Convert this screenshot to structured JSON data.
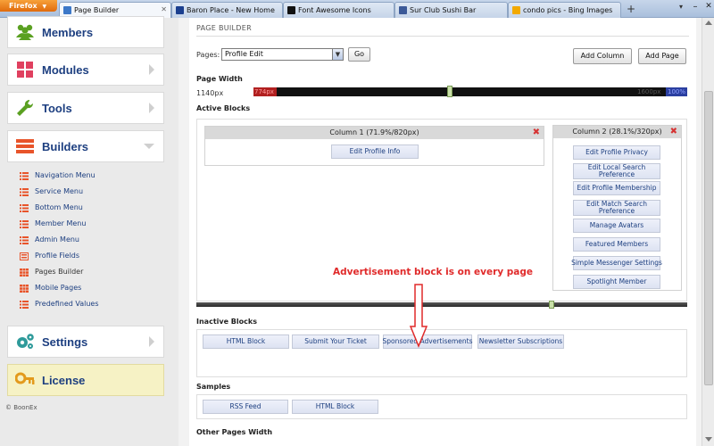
{
  "browser": {
    "firefox_button": "Firefox",
    "tabs": [
      {
        "label": "Page Builder",
        "active": true,
        "icon": "page-builder-favicon",
        "color": "#3c78c8"
      },
      {
        "label": "Baron Place - New Home",
        "active": false,
        "icon": "baron-place-favicon",
        "color": "#1b3f8f"
      },
      {
        "label": "Font Awesome Icons",
        "active": false,
        "icon": "font-awesome-favicon",
        "color": "#111111"
      },
      {
        "label": "Sur Club Sushi Bar",
        "active": false,
        "icon": "facebook-favicon",
        "color": "#3b5998"
      },
      {
        "label": "condo pics - Bing Images",
        "active": false,
        "icon": "bing-favicon",
        "color": "#f2a900"
      }
    ],
    "new_tab": "+",
    "tab_list": "▾",
    "minimize": "–",
    "close": "✕"
  },
  "sidebar": {
    "menus": [
      {
        "label": "Members",
        "icon": "members-icon",
        "color": "#5aa021",
        "arrow": "none"
      },
      {
        "label": "Modules",
        "icon": "modules-grid-icon",
        "color": "#e0405f",
        "arrow": "right"
      },
      {
        "label": "Tools",
        "icon": "wrench-icon",
        "color": "#5aa021",
        "arrow": "right"
      },
      {
        "label": "Builders",
        "icon": "builders-list-icon",
        "color": "#e8542a",
        "arrow": "down"
      },
      {
        "label": "Settings",
        "icon": "gears-icon",
        "color": "#2e9a9a",
        "arrow": "right"
      },
      {
        "label": "License",
        "icon": "key-icon",
        "color": "#e39a1c",
        "arrow": "none"
      }
    ],
    "builders_items": [
      {
        "label": "Navigation Menu",
        "icon": "list-icon"
      },
      {
        "label": "Service Menu",
        "icon": "list-icon"
      },
      {
        "label": "Bottom Menu",
        "icon": "list-icon"
      },
      {
        "label": "Member Menu",
        "icon": "list-icon"
      },
      {
        "label": "Admin Menu",
        "icon": "list-icon"
      },
      {
        "label": "Profile Fields",
        "icon": "form-icon"
      },
      {
        "label": "Pages Builder",
        "icon": "grid-icon",
        "current": true
      },
      {
        "label": "Mobile Pages",
        "icon": "grid-icon"
      },
      {
        "label": "Predefined Values",
        "icon": "list-icon"
      }
    ],
    "copyright": "© BoonEx"
  },
  "main": {
    "title": "PAGE BUILDER",
    "pages_label": "Pages:",
    "pages_selected": "Profile Edit",
    "go_button": "Go",
    "add_column_button": "Add Column",
    "add_page_button": "Add Page",
    "page_width_heading": "Page Width",
    "page_width_value": "1140px",
    "width_left_label": "774px",
    "width_right_label": "1600px",
    "width_percent_label": "100%",
    "width_fraction": 0.45,
    "active_blocks_heading": "Active Blocks",
    "columns": [
      {
        "title": "Column 1 (71.9%/820px)",
        "blocks": [
          "Edit Profile Info"
        ]
      },
      {
        "title": "Column 2 (28.1%/320px)",
        "blocks": [
          "Edit Profile Privacy",
          "Edit Local Search Preference",
          "Edit Profile Membership",
          "Edit Match Search Preference",
          "Manage Avatars",
          "Featured Members",
          "Simple Messenger Settings",
          "Spotlight Member"
        ]
      }
    ],
    "annotation": "Advertisement block is on every page",
    "annotation_color": "#e02a2a",
    "inactive_blocks_heading": "Inactive Blocks",
    "inactive_blocks": [
      "HTML Block",
      "Submit Your Ticket",
      "Sponsored Advertisements",
      "Newsletter Subscriptions"
    ],
    "samples_heading": "Samples",
    "samples": [
      "RSS Feed",
      "HTML Block"
    ],
    "other_pages_heading": "Other Pages Width"
  }
}
